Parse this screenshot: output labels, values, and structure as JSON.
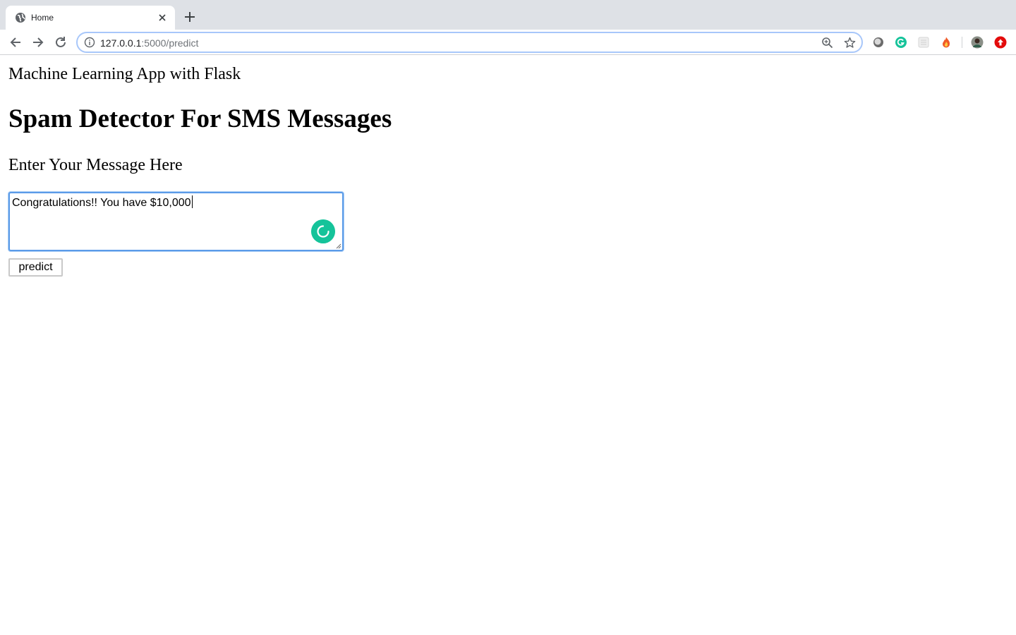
{
  "browser": {
    "tab": {
      "title": "Home"
    },
    "address_bar": {
      "host": "127.0.0.1",
      "path": ":5000/predict"
    }
  },
  "page": {
    "app_title": "Machine Learning App with Flask",
    "heading": "Spam Detector For SMS Messages",
    "prompt_label": "Enter Your Message Here",
    "message": {
      "value": "Congratulations!! You have $10,000"
    },
    "predict_button": "predict"
  },
  "colors": {
    "focus_ring": "#5b9be8",
    "grammarly_green": "#15c39a",
    "extension_red": "#e30b0b"
  }
}
